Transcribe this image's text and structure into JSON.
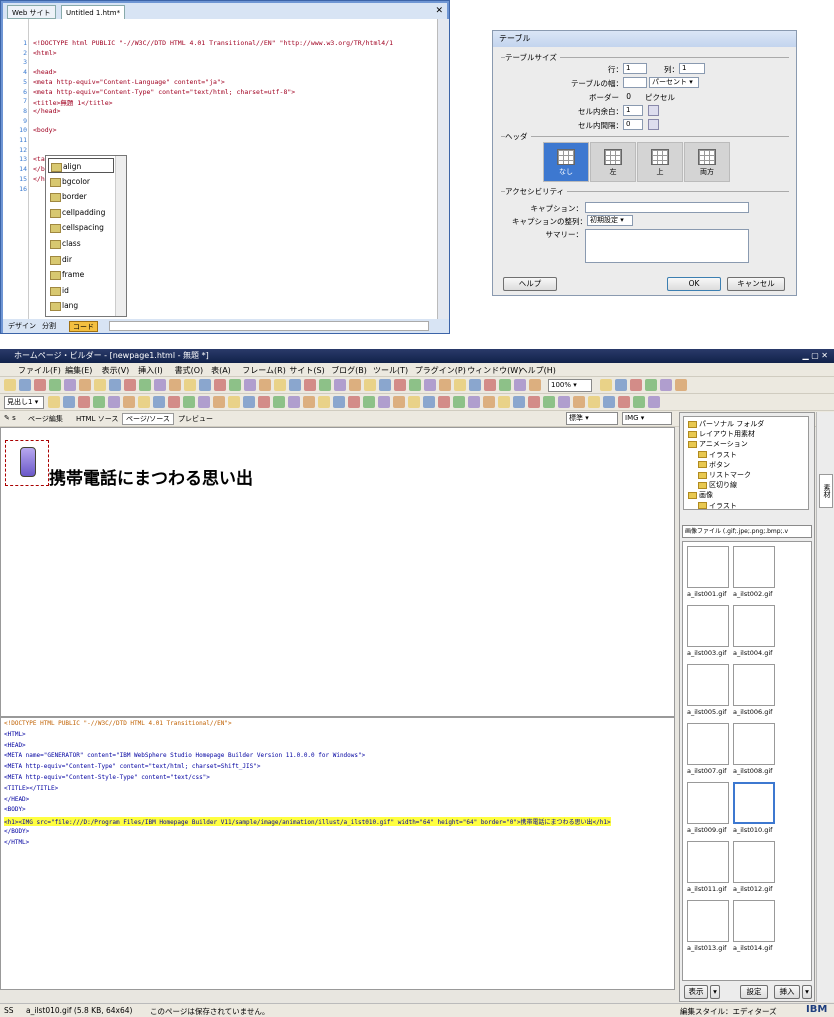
{
  "editor": {
    "tabs": [
      "Web サイト",
      "Untitled 1.htm*"
    ],
    "lines": [
      {
        "n": "1",
        "t": "<!DOCTYPE html PUBLIC \"-//W3C//DTD HTML 4.01 Transitional//EN\" \"http://www.w3.org/TR/html4/1"
      },
      {
        "n": "2",
        "t": "<html>"
      },
      {
        "n": "3",
        "t": ""
      },
      {
        "n": "4",
        "t": "<head>"
      },
      {
        "n": "5",
        "t": "<meta http-equiv=\"Content-Language\" content=\"ja\">"
      },
      {
        "n": "6",
        "t": "<meta http-equiv=\"Content-Type\" content=\"text/html; charset=utf-8\">"
      },
      {
        "n": "7",
        "t": "<title>無題 1</title>"
      },
      {
        "n": "8",
        "t": "</head>"
      },
      {
        "n": "9",
        "t": ""
      },
      {
        "n": "10",
        "t": "<body>"
      },
      {
        "n": "11",
        "t": ""
      },
      {
        "n": "12",
        "t": ""
      },
      {
        "n": "13",
        "t": "<table |"
      },
      {
        "n": "14",
        "t": "</bo"
      },
      {
        "n": "15",
        "t": "</ht"
      },
      {
        "n": "16",
        "t": ""
      }
    ],
    "autocomplete": [
      "align",
      "bgcolor",
      "border",
      "cellpadding",
      "cellspacing",
      "class",
      "dir",
      "frame",
      "id",
      "lang"
    ],
    "view_tabs": [
      "デザイン",
      "分割",
      "コード"
    ]
  },
  "dialog": {
    "title": "テーブル",
    "section_size": "テーブルサイズ",
    "rows_label": "行：",
    "rows": "1",
    "cols_label": "列：",
    "cols": "1",
    "width_label": "テーブルの幅：",
    "width_unit": "パーセント",
    "border_label": "ボーダー",
    "border": "0",
    "border_unit": "ピクセル",
    "padding_label": "セル内余白：",
    "padding": "1",
    "spacing_label": "セル内間隔：",
    "spacing": "0",
    "section_header": "ヘッダ",
    "headers": [
      "なし",
      "左",
      "上",
      "両方"
    ],
    "section_access": "アクセシビリティ",
    "caption_label": "キャプション：",
    "caption_align_label": "キャプションの整列：",
    "caption_align": "初期設定",
    "summary_label": "サマリー：",
    "help": "ヘルプ",
    "ok": "OK",
    "cancel": "キャンセル"
  },
  "app": {
    "title": "ホームページ・ビルダー - [newpage1.html - 無題 *]",
    "menu": [
      "ファイル(F)",
      "編集(E)",
      "表示(V)",
      "挿入(I)",
      "書式(O)",
      "表(A)",
      "フレーム(R)",
      "サイト(S)",
      "ブログ(B)",
      "ツール(T)",
      "プラグイン(P)",
      "ウィンドウ(W)",
      "ヘルプ(H)"
    ],
    "zoom": "100%",
    "style_select": "見出し1",
    "view_tabs": [
      "ページ編集",
      "HTML ソース",
      "ページ/ソース",
      "プレビュー"
    ],
    "std_select": "標準",
    "img_select": "IMG",
    "heading_text": "携帯電話にまつわる思い出",
    "source": [
      "<!DOCTYPE HTML PUBLIC \"-//W3C//DTD HTML 4.01 Transitional//EN\">",
      "<HTML>",
      "<HEAD>",
      "<META name=\"GENERATOR\" content=\"IBM WebSphere Studio Homepage Builder Version 11.0.0.0 for Windows\">",
      "<META http-equiv=\"Content-Type\" content=\"text/html; charset=Shift_JIS\">",
      "<META http-equiv=\"Content-Style-Type\" content=\"text/css\">",
      "<TITLE></TITLE>",
      "</HEAD>",
      "<BODY>",
      "<h1><IMG src=\"file:///D:/Program Files/IBM Homepage Builder V11/sample/image/animation/illust/a_ilst010.gif\" width=\"64\" height=\"64\" border=\"0\">携帯電話にまつわる思い出</h1>",
      "</BODY>",
      "</HTML>"
    ],
    "tree": [
      "パーソナル フォルダ",
      "レイアウト用素材",
      "アニメーション",
      "イラスト",
      "ボタン",
      "リストマーク",
      "区切り線",
      "画像",
      "イラスト"
    ],
    "file_type": "画像ファイル (.gif;.jpe;.png;.bmp;.v",
    "thumbs": [
      "a_ilst001.gif",
      "a_ilst002.gif",
      "a_ilst003.gif",
      "a_ilst004.gif",
      "a_ilst005.gif",
      "a_ilst006.gif",
      "a_ilst007.gif",
      "a_ilst008.gif",
      "a_ilst009.gif",
      "a_ilst010.gif",
      "a_ilst011.gif",
      "a_ilst012.gif",
      "a_ilst013.gif",
      "a_ilst014.gif"
    ],
    "panel_buttons": [
      "表示",
      "設定",
      "挿入"
    ],
    "side_tab": "素材",
    "status_left": "SS",
    "status_file": "a_ilst010.gif (5.8 KB, 64x64)",
    "status_msg": "このページは保存されていません。",
    "status_right": "編集スタイル：エディターズ",
    "ibm": "IBM"
  },
  "colors": {
    "accent": "#3d78d0",
    "source_tag": "#0000a0",
    "source_attr": "#c06000"
  }
}
